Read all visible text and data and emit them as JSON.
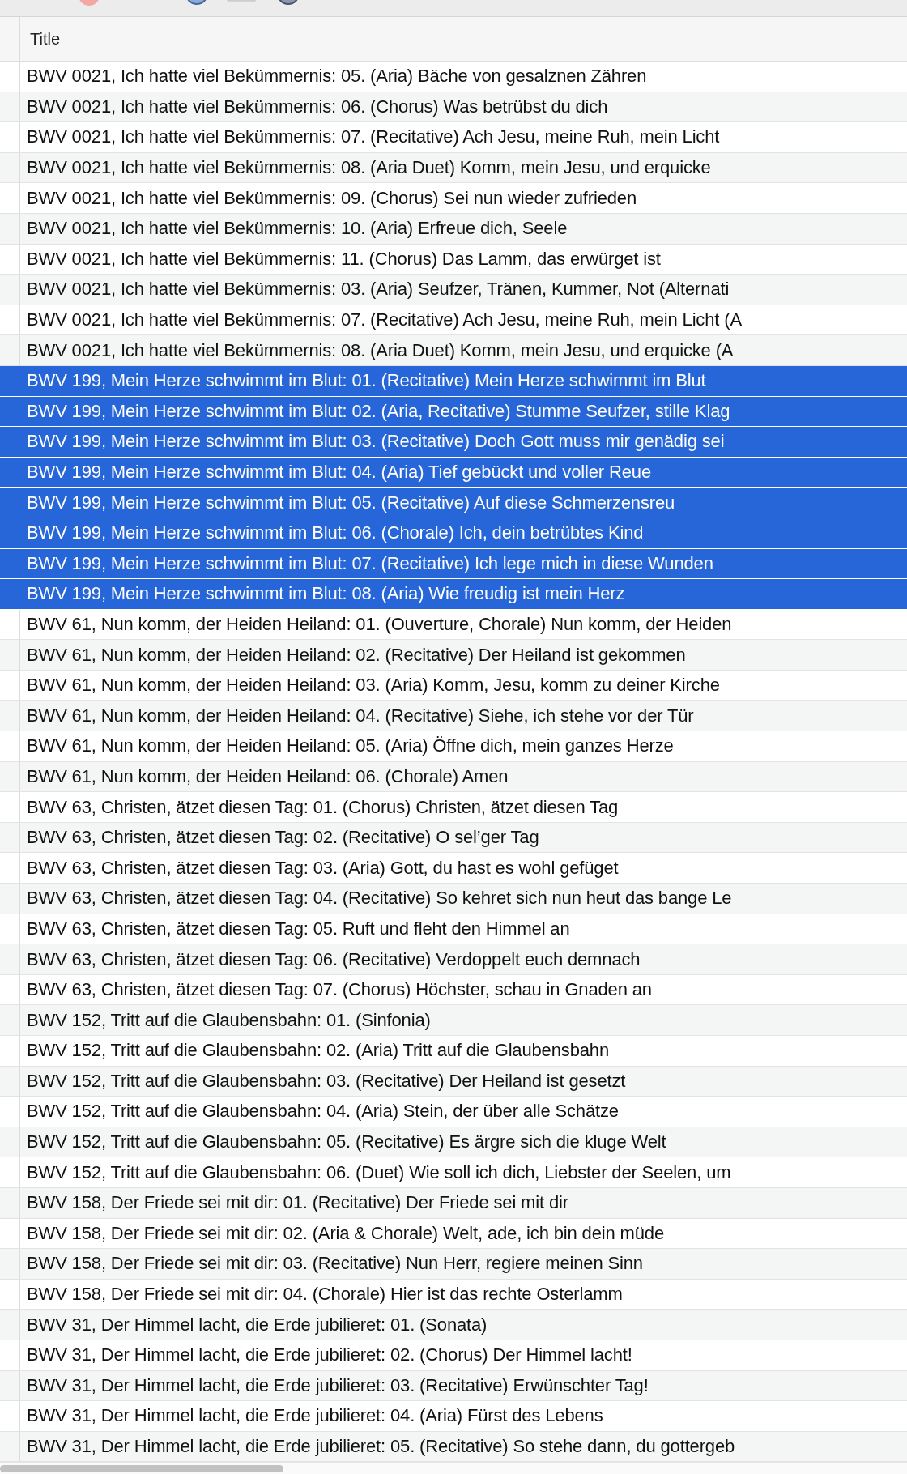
{
  "table": {
    "columns": [
      {
        "label": "Title"
      }
    ],
    "rows": [
      {
        "title": "BWV 0021, Ich hatte viel Bekümmernis: 05. (Aria) Bäche von gesalznen Zähren",
        "selected": false
      },
      {
        "title": "BWV 0021, Ich hatte viel Bekümmernis: 06. (Chorus) Was betrübst du dich",
        "selected": false
      },
      {
        "title": "BWV 0021, Ich hatte viel Bekümmernis: 07. (Recitative) Ach Jesu, meine Ruh, mein Licht",
        "selected": false
      },
      {
        "title": "BWV 0021, Ich hatte viel Bekümmernis: 08. (Aria Duet) Komm, mein Jesu, und erquicke",
        "selected": false
      },
      {
        "title": "BWV 0021, Ich hatte viel Bekümmernis: 09. (Chorus) Sei nun wieder zufrieden",
        "selected": false
      },
      {
        "title": "BWV 0021, Ich hatte viel Bekümmernis: 10. (Aria) Erfreue dich, Seele",
        "selected": false
      },
      {
        "title": "BWV 0021, Ich hatte viel Bekümmernis: 11. (Chorus) Das Lamm, das erwürget ist",
        "selected": false
      },
      {
        "title": "BWV 0021, Ich hatte viel Bekümmernis: 03. (Aria) Seufzer, Tränen, Kummer, Not (Alternati",
        "selected": false
      },
      {
        "title": "BWV 0021, Ich hatte viel Bekümmernis: 07. (Recitative) Ach Jesu, meine Ruh, mein Licht (A",
        "selected": false
      },
      {
        "title": "BWV 0021, Ich hatte viel Bekümmernis: 08. (Aria Duet) Komm, mein Jesu, und erquicke (A",
        "selected": false
      },
      {
        "title": "BWV 199, Mein Herze schwimmt im Blut: 01. (Recitative) Mein Herze schwimmt im Blut",
        "selected": true
      },
      {
        "title": "BWV 199, Mein Herze schwimmt im Blut: 02. (Aria, Recitative) Stumme Seufzer, stille Klag",
        "selected": true
      },
      {
        "title": "BWV 199, Mein Herze schwimmt im Blut: 03. (Recitative) Doch Gott muss mir genädig sei",
        "selected": true
      },
      {
        "title": "BWV 199, Mein Herze schwimmt im Blut: 04. (Aria) Tief gebückt und voller Reue",
        "selected": true
      },
      {
        "title": "BWV 199, Mein Herze schwimmt im Blut: 05. (Recitative) Auf diese Schmerzensreu",
        "selected": true
      },
      {
        "title": "BWV 199, Mein Herze schwimmt im Blut: 06. (Chorale) Ich, dein betrübtes Kind",
        "selected": true
      },
      {
        "title": "BWV 199, Mein Herze schwimmt im Blut: 07. (Recitative) Ich lege mich in diese Wunden",
        "selected": true
      },
      {
        "title": "BWV 199, Mein Herze schwimmt im Blut: 08. (Aria) Wie freudig ist mein Herz",
        "selected": true
      },
      {
        "title": "BWV 61, Nun komm, der Heiden Heiland: 01. (Ouverture, Chorale) Nun komm, der Heiden",
        "selected": false
      },
      {
        "title": "BWV 61, Nun komm, der Heiden Heiland: 02. (Recitative) Der Heiland ist gekommen",
        "selected": false
      },
      {
        "title": "BWV 61, Nun komm, der Heiden Heiland: 03. (Aria) Komm, Jesu, komm zu deiner Kirche",
        "selected": false
      },
      {
        "title": "BWV 61, Nun komm, der Heiden Heiland: 04. (Recitative) Siehe, ich stehe vor der Tür",
        "selected": false
      },
      {
        "title": "BWV 61, Nun komm, der Heiden Heiland: 05. (Aria) Öffne dich, mein ganzes Herze",
        "selected": false
      },
      {
        "title": "BWV 61, Nun komm, der Heiden Heiland: 06. (Chorale) Amen",
        "selected": false
      },
      {
        "title": "BWV 63, Christen, ätzet diesen Tag: 01. (Chorus) Christen, ätzet diesen Tag",
        "selected": false
      },
      {
        "title": "BWV 63, Christen, ätzet diesen Tag: 02. (Recitative) O sel’ger Tag",
        "selected": false
      },
      {
        "title": "BWV 63, Christen, ätzet diesen Tag: 03. (Aria) Gott, du hast es wohl gefüget",
        "selected": false
      },
      {
        "title": "BWV 63, Christen, ätzet diesen Tag: 04. (Recitative) So kehret sich nun heut das bange Le",
        "selected": false
      },
      {
        "title": "BWV 63, Christen, ätzet diesen Tag: 05. Ruft und fleht den Himmel an",
        "selected": false
      },
      {
        "title": "BWV 63, Christen, ätzet diesen Tag: 06. (Recitative) Verdoppelt euch demnach",
        "selected": false
      },
      {
        "title": "BWV 63, Christen, ätzet diesen Tag: 07. (Chorus) Höchster, schau in Gnaden an",
        "selected": false
      },
      {
        "title": "BWV 152, Tritt auf die Glaubensbahn: 01. (Sinfonia)",
        "selected": false
      },
      {
        "title": "BWV 152, Tritt auf die Glaubensbahn: 02. (Aria) Tritt auf die Glaubensbahn",
        "selected": false
      },
      {
        "title": "BWV 152, Tritt auf die Glaubensbahn: 03. (Recitative) Der Heiland ist gesetzt",
        "selected": false
      },
      {
        "title": "BWV 152, Tritt auf die Glaubensbahn: 04. (Aria) Stein, der über alle Schätze",
        "selected": false
      },
      {
        "title": "BWV 152, Tritt auf die Glaubensbahn: 05. (Recitative) Es ärgre sich die kluge Welt",
        "selected": false
      },
      {
        "title": "BWV 152, Tritt auf die Glaubensbahn: 06. (Duet) Wie soll ich dich, Liebster der Seelen, um",
        "selected": false
      },
      {
        "title": "BWV 158, Der Friede sei mit dir: 01. (Recitative) Der Friede sei mit dir",
        "selected": false
      },
      {
        "title": "BWV 158, Der Friede sei mit dir: 02. (Aria & Chorale) Welt, ade, ich bin dein müde",
        "selected": false
      },
      {
        "title": "BWV 158, Der Friede sei mit dir: 03. (Recitative) Nun Herr, regiere meinen Sinn",
        "selected": false
      },
      {
        "title": "BWV 158, Der Friede sei mit dir: 04. (Chorale) Hier ist das rechte Osterlamm",
        "selected": false
      },
      {
        "title": "BWV 31, Der Himmel lacht, die Erde jubilieret: 01. (Sonata)",
        "selected": false
      },
      {
        "title": "BWV 31, Der Himmel lacht, die Erde jubilieret: 02. (Chorus) Der Himmel lacht!",
        "selected": false
      },
      {
        "title": "BWV 31, Der Himmel lacht, die Erde jubilieret: 03. (Recitative) Erwünschter Tag!",
        "selected": false
      },
      {
        "title": "BWV 31, Der Himmel lacht, die Erde jubilieret: 04. (Aria) Fürst des Lebens",
        "selected": false
      },
      {
        "title": "BWV 31, Der Himmel lacht, die Erde jubilieret: 05. (Recitative) So stehe dann, du gottergeb",
        "selected": false
      }
    ]
  }
}
